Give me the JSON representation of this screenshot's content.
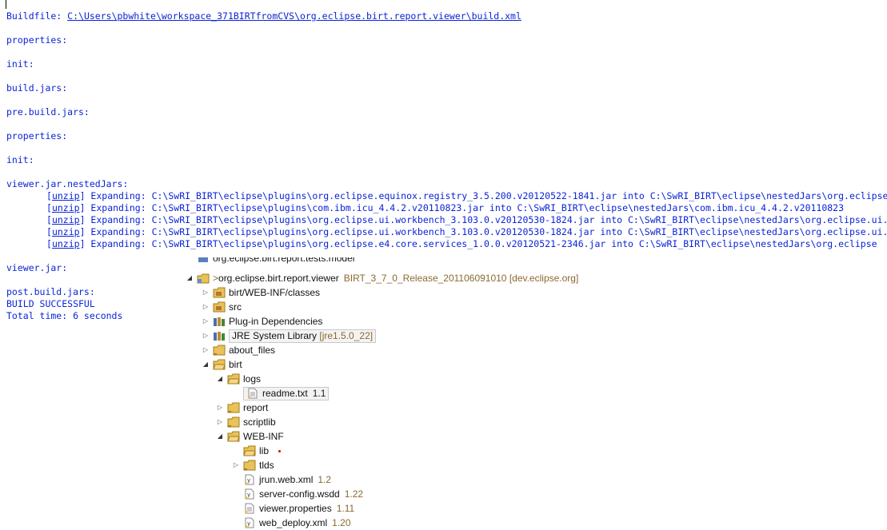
{
  "console": {
    "buildfile_label": "Buildfile: ",
    "buildfile_path": "C:\\Users\\pbwhite\\workspace_371BIRTfromCVS\\org.eclipse.birt.report.viewer\\build.xml",
    "targets": [
      "properties:",
      "init:",
      "build.jars:",
      "pre.build.jars:",
      "properties:",
      "init:",
      "viewer.jar.nestedJars:"
    ],
    "unzip_tag": "unzip",
    "unzip_lines": [
      " Expanding: C:\\SwRI_BIRT\\eclipse\\plugins\\org.eclipse.equinox.registry_3.5.200.v20120522-1841.jar into C:\\SwRI_BIRT\\eclipse\\nestedJars\\org.eclipse",
      " Expanding: C:\\SwRI_BIRT\\eclipse\\plugins\\com.ibm.icu_4.4.2.v20110823.jar into C:\\SwRI_BIRT\\eclipse\\nestedJars\\com.ibm.icu_4.4.2.v20110823",
      " Expanding: C:\\SwRI_BIRT\\eclipse\\plugins\\org.eclipse.ui.workbench_3.103.0.v20120530-1824.jar into C:\\SwRI_BIRT\\eclipse\\nestedJars\\org.eclipse.ui.",
      " Expanding: C:\\SwRI_BIRT\\eclipse\\plugins\\org.eclipse.ui.workbench_3.103.0.v20120530-1824.jar into C:\\SwRI_BIRT\\eclipse\\nestedJars\\org.eclipse.ui.",
      " Expanding: C:\\SwRI_BIRT\\eclipse\\plugins\\org.eclipse.e4.core.services_1.0.0.v20120521-2346.jar into C:\\SwRI_BIRT\\eclipse\\nestedJars\\org.eclipse"
    ],
    "viewer_jar": "viewer.jar:",
    "post_build": "post.build.jars:",
    "result": "BUILD SUCCESSFUL",
    "total_time": "Total time: 6 seconds"
  },
  "tree": {
    "cut_top_label": "org.eclipse.birt.report.tests.model",
    "project": {
      "prefix": ">",
      "name": "org.eclipse.birt.report.viewer",
      "decoration": "BIRT_3_7_0_Release_201106091010 [dev.eclipse.org]"
    },
    "items": [
      {
        "label": "birt/WEB-INF/classes",
        "decoration": ""
      },
      {
        "label": "src",
        "decoration": ""
      },
      {
        "label": "Plug-in Dependencies",
        "decoration": ""
      },
      {
        "label": "JRE System Library",
        "decoration": "[jre1.5.0_22]"
      },
      {
        "label": "about_files",
        "decoration": ""
      },
      {
        "label": "birt",
        "decoration": ""
      },
      {
        "label": "logs",
        "decoration": ""
      },
      {
        "label": "readme.txt",
        "decoration": "1.1"
      },
      {
        "label": "report",
        "decoration": ""
      },
      {
        "label": "scriptlib",
        "decoration": ""
      },
      {
        "label": "WEB-INF",
        "decoration": ""
      },
      {
        "label": "lib",
        "decoration": ""
      },
      {
        "label": "tlds",
        "decoration": ""
      },
      {
        "label": "jrun.web.xml",
        "decoration": "1.2"
      },
      {
        "label": "server-config.wsdd",
        "decoration": "1.22"
      },
      {
        "label": "viewer.properties",
        "decoration": "1.11"
      },
      {
        "label": "web_deploy.xml",
        "decoration": "1.20"
      }
    ]
  },
  "colors": {
    "console_text": "#0b24d6",
    "decoration": "#8a6a2f",
    "error_marker": "#d40000"
  }
}
